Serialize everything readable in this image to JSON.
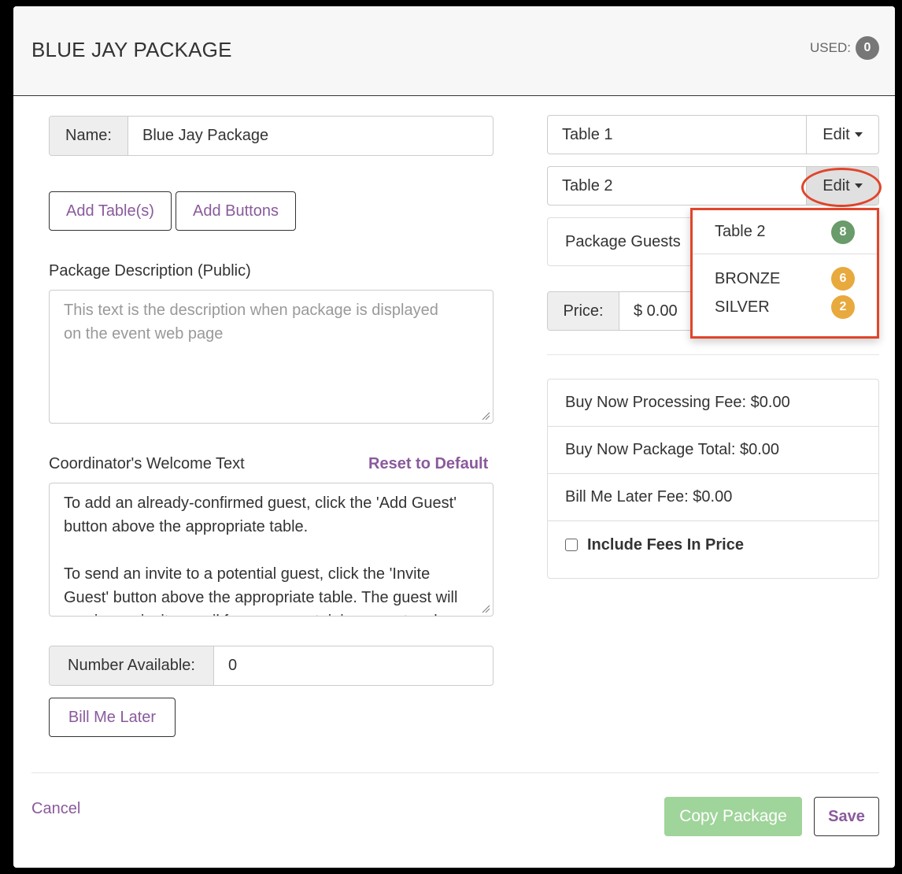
{
  "header": {
    "title": "BLUE JAY PACKAGE",
    "used_label": "USED:",
    "used_count": "0"
  },
  "form": {
    "name_label": "Name:",
    "name_value": "Blue Jay Package",
    "add_tables_label": "Add Table(s)",
    "add_buttons_label": "Add Buttons",
    "description_label": "Package Description (Public)",
    "description_placeholder_line1": "This text is the description when package is displayed",
    "description_placeholder_line2": "on the event web page",
    "welcome_label": "Coordinator's Welcome Text",
    "reset_label": "Reset to Default",
    "welcome_line1": "To add an already-confirmed guest, click the 'Add Guest'",
    "welcome_line2": "button above the appropriate table.",
    "welcome_line3": "To send an invite to a potential guest, click the 'Invite",
    "welcome_line4": "Guest' button above the appropriate table. The guest will",
    "welcome_line5": "receive an invite email from you containing a custom l",
    "number_available_label": "Number Available:",
    "number_available_value": "0",
    "bill_me_later_label": "Bill Me Later"
  },
  "tables": {
    "table1_name": "Table 1",
    "table2_name": "Table 2",
    "edit_label": "Edit",
    "package_guests_label": "Package Guests",
    "price_label": "Price:",
    "price_value": "$ 0.00"
  },
  "dropdown": {
    "items": [
      {
        "label": "Table 2",
        "count": "8",
        "color": "#6a9b6a"
      },
      {
        "label": "BRONZE",
        "count": "6",
        "color": "#e8a93d"
      },
      {
        "label": "SILVER",
        "count": "2",
        "color": "#e8a93d"
      }
    ]
  },
  "fees": {
    "processing": "Buy Now Processing Fee: $0.00",
    "package_total": "Buy Now Package Total: $0.00",
    "bill_later_fee": "Bill Me Later Fee: $0.00",
    "include_fees": "Include Fees In Price"
  },
  "footer": {
    "cancel_label": "Cancel",
    "copy_label": "Copy Package",
    "save_label": "Save"
  },
  "colors": {
    "accent_purple": "#8a5a9c",
    "copy_green": "#9fd49a",
    "annotation_red": "#e0452b",
    "badge_gray": "#777777"
  }
}
